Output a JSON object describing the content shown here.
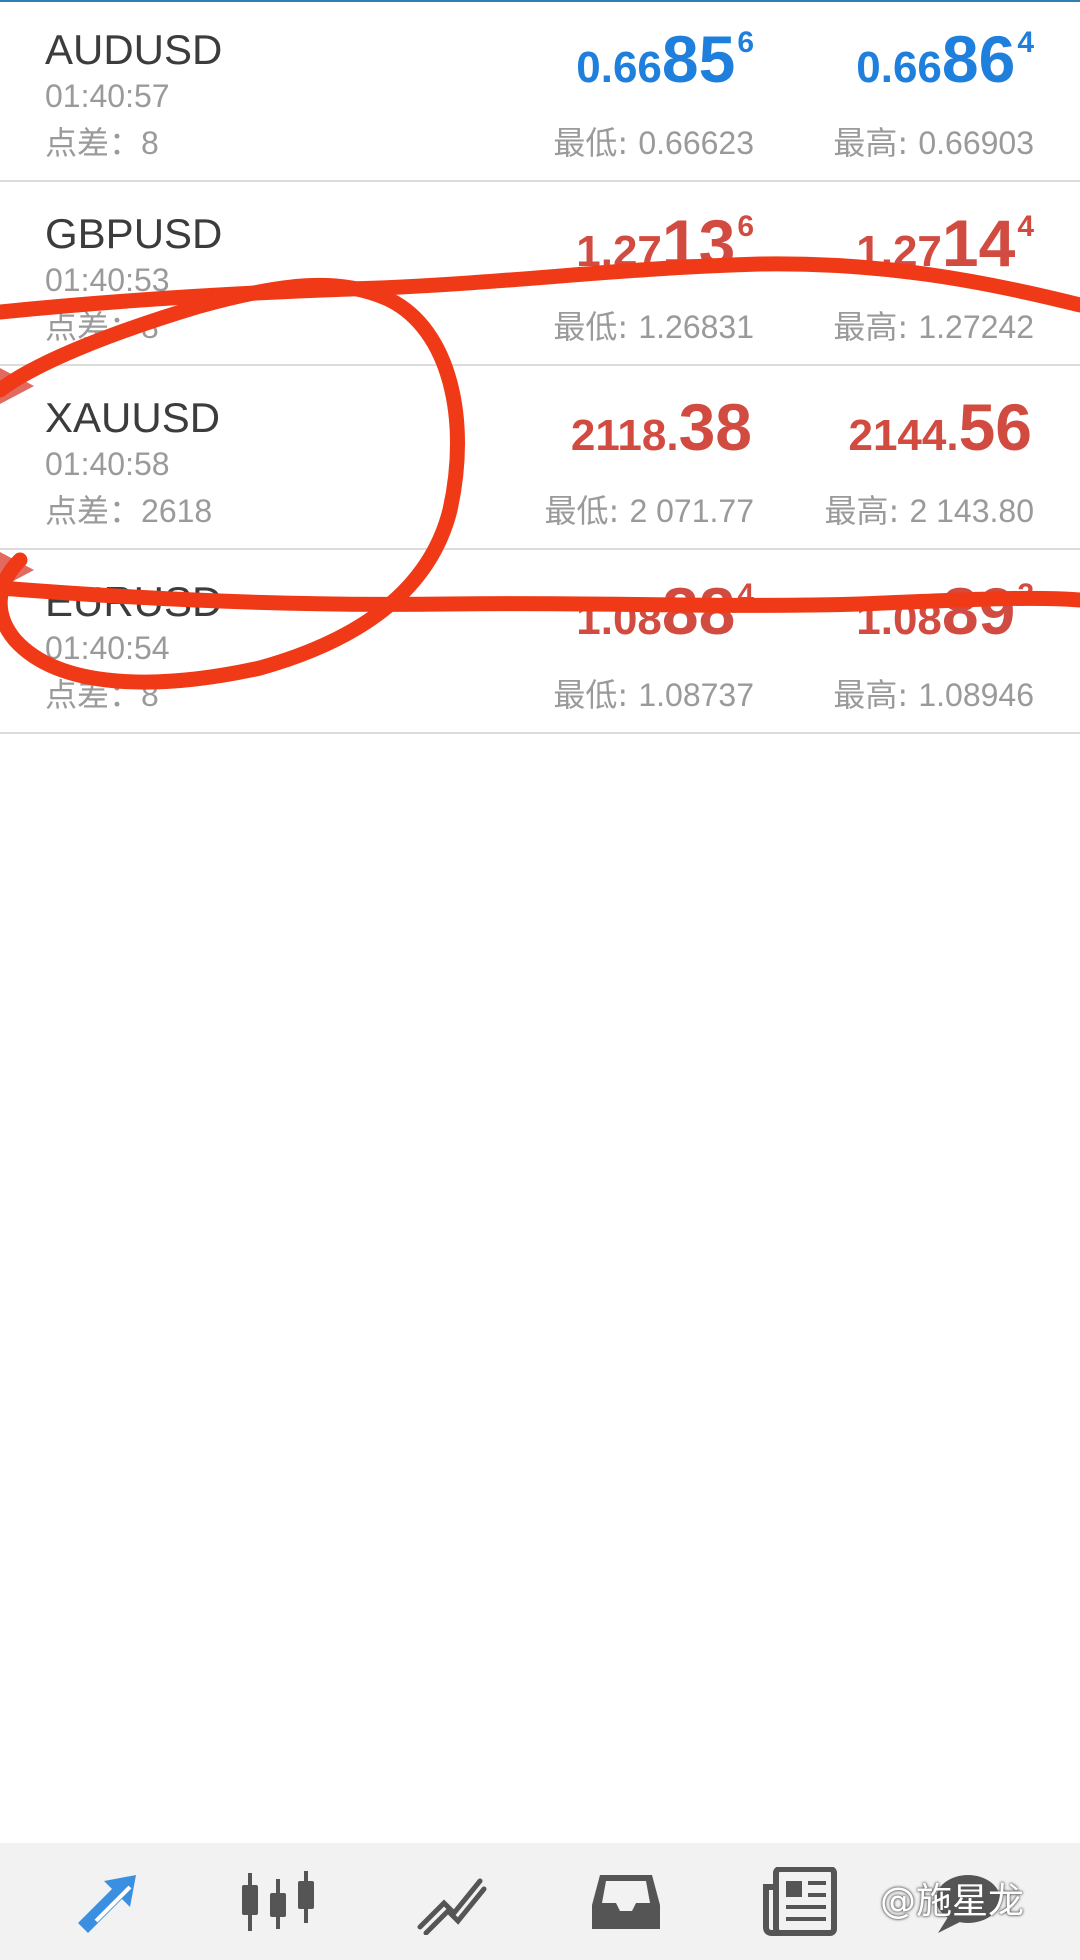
{
  "quotes": [
    {
      "symbol": "AUDUSD",
      "time": "01:40:57",
      "spread_label": "点差：",
      "spread": "8",
      "bid": {
        "prefix": "0.66",
        "big": "85",
        "sup": "6"
      },
      "ask": {
        "prefix": "0.66",
        "big": "86",
        "sup": "4"
      },
      "low_label": "最低: ",
      "low": "0.66623",
      "high_label": "最高: ",
      "high": "0.66903",
      "color": "#1f7fdc"
    },
    {
      "symbol": "GBPUSD",
      "time": "01:40:53",
      "spread_label": "点差：",
      "spread": "8",
      "bid": {
        "prefix": "1.27",
        "big": "13",
        "sup": "6"
      },
      "ask": {
        "prefix": "1.27",
        "big": "14",
        "sup": "4"
      },
      "low_label": "最低: ",
      "low": "1.26831",
      "high_label": "最高: ",
      "high": "1.27242",
      "color": "#d24b41"
    },
    {
      "symbol": "XAUUSD",
      "time": "01:40:58",
      "spread_label": "点差：",
      "spread": "2618",
      "bid": {
        "prefix": "2118.",
        "big": "38",
        "sup": ""
      },
      "ask": {
        "prefix": "2144.",
        "big": "56",
        "sup": ""
      },
      "low_label": "最低: ",
      "low": "2 071.77",
      "high_label": "最高: ",
      "high": "2 143.80",
      "color": "#d24b41"
    },
    {
      "symbol": "EURUSD",
      "time": "01:40:54",
      "spread_label": "点差：",
      "spread": "8",
      "bid": {
        "prefix": "1.08",
        "big": "88",
        "sup": "4"
      },
      "ask": {
        "prefix": "1.08",
        "big": "89",
        "sup": "2"
      },
      "low_label": "最低: ",
      "low": "1.08737",
      "high_label": "最高: ",
      "high": "1.08946",
      "color": "#d24b41"
    }
  ],
  "bottom_nav": {
    "items": [
      {
        "icon": "quotes-icon",
        "active": true
      },
      {
        "icon": "chart-icon",
        "active": false
      },
      {
        "icon": "trade-icon",
        "active": false
      },
      {
        "icon": "history-icon",
        "active": false
      },
      {
        "icon": "news-icon",
        "active": false
      },
      {
        "icon": "chat-icon",
        "active": false
      }
    ]
  },
  "watermark": "@施星龙",
  "colors": {
    "up": "#1f7fdc",
    "down": "#d24b41",
    "annotation": "#f03a17",
    "nav_active": "#3a8fe0",
    "nav_inactive": "#555555"
  }
}
